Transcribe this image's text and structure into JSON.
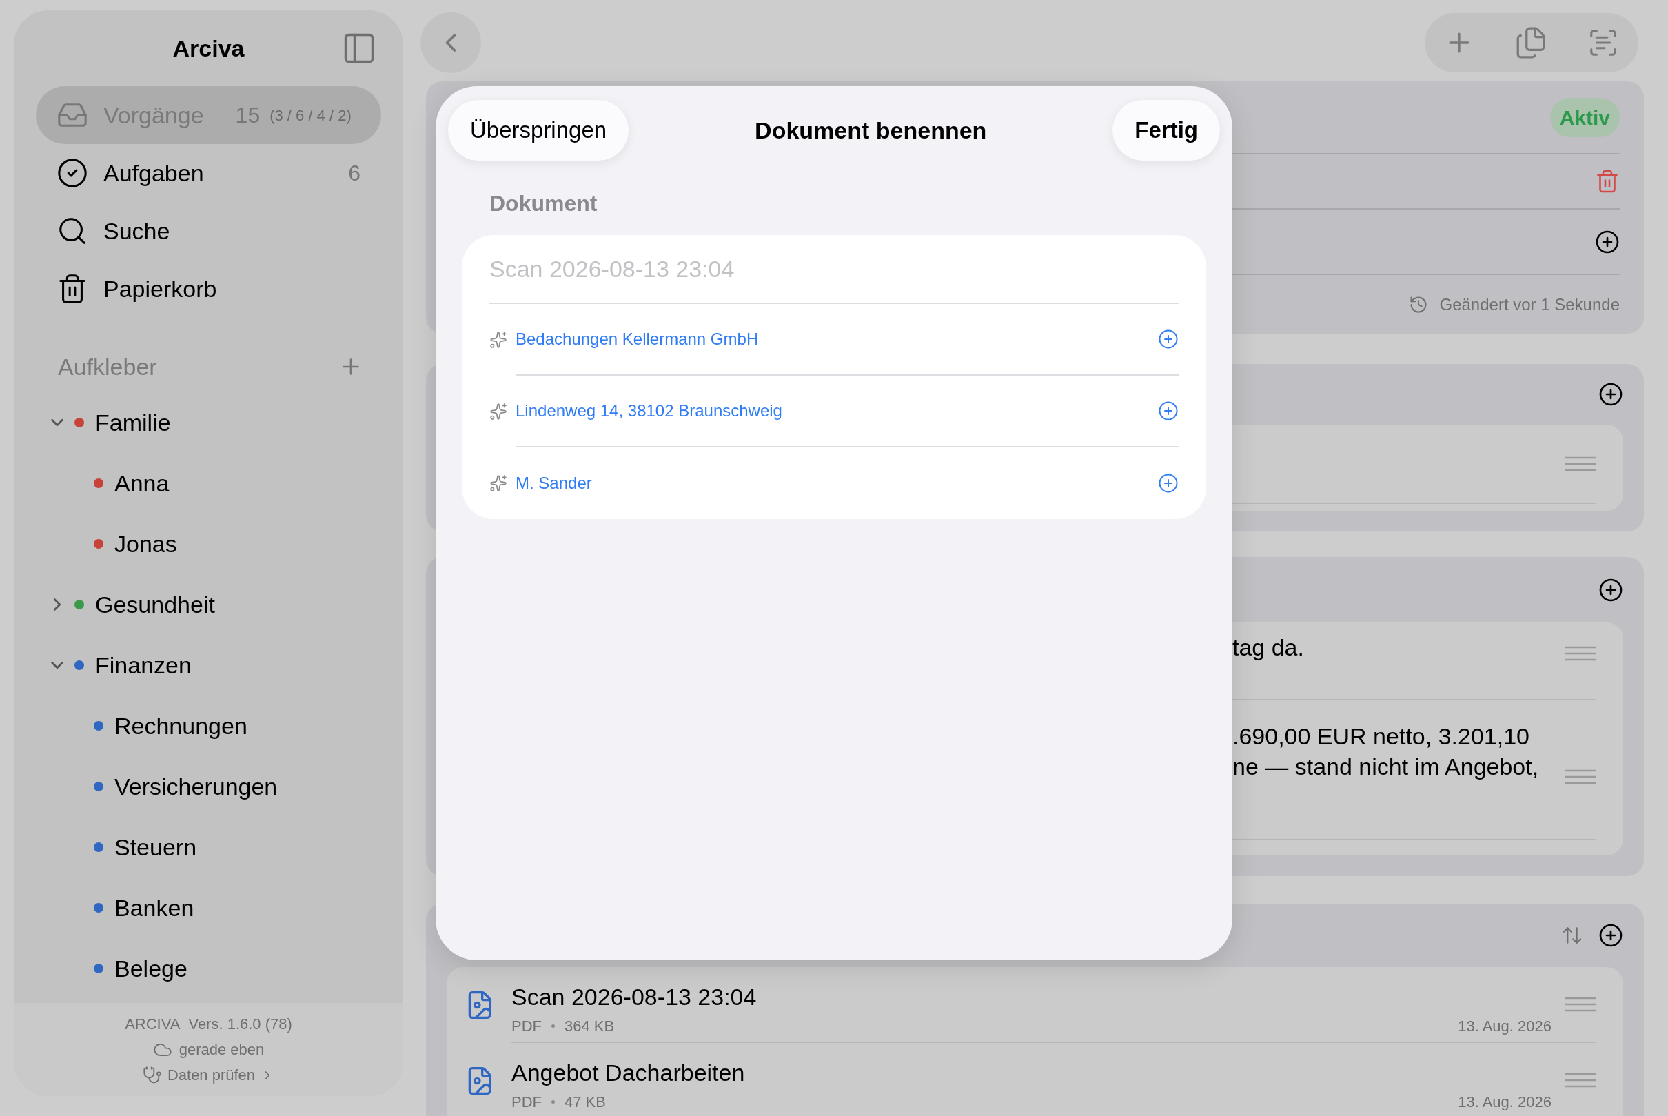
{
  "sidebar": {
    "title": "Arciva",
    "nav": [
      {
        "label": "Vorgänge",
        "count": "15",
        "detail": "(3 / 6 / 4 / 2)",
        "selected": true
      },
      {
        "label": "Aufgaben",
        "count": "6",
        "selected": false
      },
      {
        "label": "Suche",
        "selected": false
      },
      {
        "label": "Papierkorb",
        "selected": false
      }
    ],
    "stickers_header": "Aufkleber",
    "stickers": [
      {
        "label": "Familie",
        "color": "#c8423a",
        "expanded": true,
        "children": [
          {
            "label": "Anna",
            "color": "#c8423a"
          },
          {
            "label": "Jonas",
            "color": "#c8423a"
          }
        ]
      },
      {
        "label": "Gesundheit",
        "color": "#3a9a4a",
        "expanded": false
      },
      {
        "label": "Finanzen",
        "color": "#2f67c2",
        "expanded": true,
        "children": [
          {
            "label": "Rechnungen",
            "color": "#2f67c2"
          },
          {
            "label": "Versicherungen",
            "color": "#2f67c2"
          },
          {
            "label": "Steuern",
            "color": "#2f67c2"
          },
          {
            "label": "Banken",
            "color": "#2f67c2"
          },
          {
            "label": "Belege",
            "color": "#2f67c2"
          }
        ]
      }
    ],
    "footer": {
      "app": "ARCIVA",
      "version": "Vers. 1.6.0 (78)",
      "sync": "gerade eben",
      "check": "Daten prüfen"
    }
  },
  "main": {
    "status_badge": "Aktiv",
    "modified": "Geändert vor 1 Sekunde",
    "notes": [
      {
        "lines": [
          "tag da."
        ]
      },
      {
        "lines": [
          ".690,00 EUR netto, 3.201,10",
          "ne — stand nicht im Angebot,"
        ]
      }
    ],
    "documents": [
      {
        "name": "Scan 2026-08-13 23:04",
        "type": "PDF",
        "size": "364 KB",
        "date": "13. Aug. 2026"
      },
      {
        "name": "Angebot Dacharbeiten",
        "type": "PDF",
        "size": "47 KB",
        "date": "13. Aug. 2026"
      }
    ]
  },
  "modal": {
    "skip": "Überspringen",
    "title": "Dokument benennen",
    "done": "Fertig",
    "section": "Dokument",
    "field": {
      "placeholder": "Scan 2026-08-13 23:04"
    },
    "suggestions": [
      "Bedachungen Kellermann GmbH",
      "Lindenweg 14, 38102 Braunschweig",
      "M. Sander"
    ]
  }
}
